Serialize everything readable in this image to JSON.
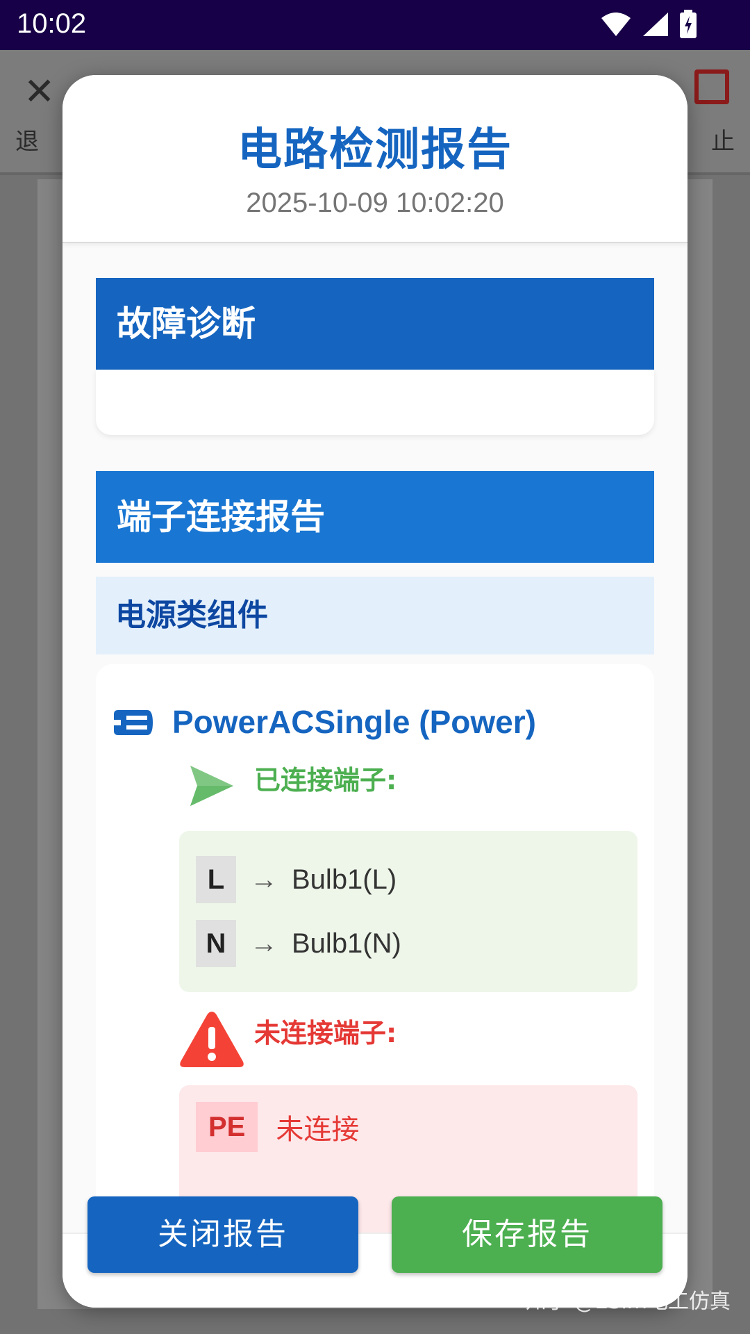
{
  "status_bar": {
    "time": "10:02"
  },
  "background_app": {
    "toolbar": {
      "exit_label": "退",
      "stop_label": "止"
    }
  },
  "report": {
    "title": "电路检测报告",
    "timestamp": "2025-10-09 10:02:20",
    "diagnosis": {
      "heading": "故障诊断"
    },
    "terminal_report": {
      "heading": "端子连接报告",
      "group": "电源类组件",
      "component": {
        "name": "PowerACSingle (Power)",
        "connected_label": "已连接端子:",
        "connected": [
          {
            "terminal": "L",
            "arrow": "→",
            "target": "Bulb1(L)"
          },
          {
            "terminal": "N",
            "arrow": "→",
            "target": "Bulb1(N)"
          }
        ],
        "unconnected_label": "未连接端子:",
        "unconnected": [
          {
            "terminal": "PE",
            "status": "未连接"
          }
        ]
      }
    },
    "buttons": {
      "close": "关闭报告",
      "save": "保存报告"
    }
  },
  "watermark": "知乎 @ESim电工仿真",
  "colors": {
    "primary": "#1565c0",
    "success": "#4caf50",
    "error": "#e53935",
    "status_bar": "#170047"
  }
}
